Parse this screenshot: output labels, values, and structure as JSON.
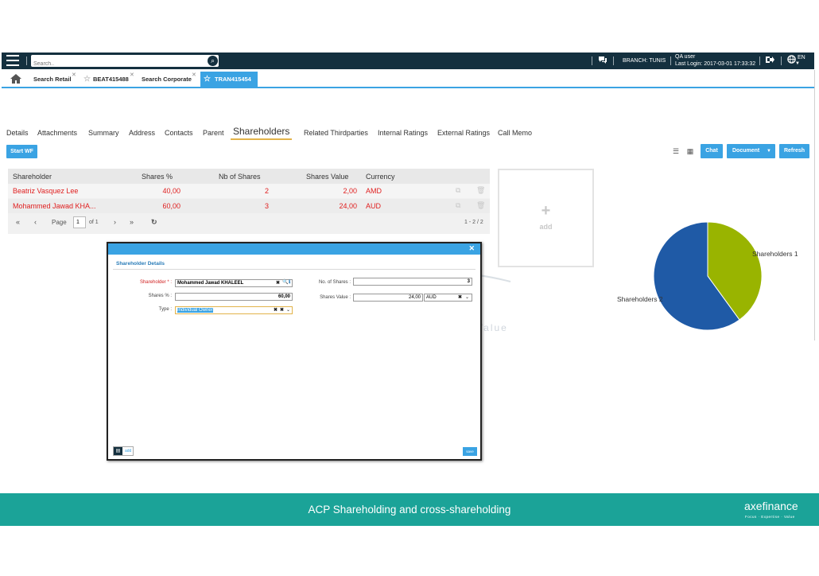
{
  "topbar": {
    "search_placeholder": "Search..",
    "branch": "BRANCH: TUNIS",
    "user": "QA user",
    "last_login": "Last Login: 2017-03-01 17:33:32",
    "lang": "EN"
  },
  "tabs": [
    {
      "label": "Search Retail"
    },
    {
      "label": "BEAT415488"
    },
    {
      "label": "Search Corporate"
    },
    {
      "label": "TRAN415454"
    }
  ],
  "subtabs": [
    "Details",
    "Attachments",
    "Summary",
    "Address",
    "Contacts",
    "Parent",
    "Shareholders",
    "Related Thirdparties",
    "Internal Ratings",
    "External Ratings",
    "Call Memo"
  ],
  "toolbar": {
    "start_wf": "Start WF",
    "chat": "Chat",
    "document": "Document",
    "refresh": "Refresh"
  },
  "table": {
    "headers": [
      "Shareholder",
      "Shares %",
      "Nb of Shares",
      "Shares Value",
      "Currency"
    ],
    "rows": [
      {
        "shareholder": "Beatriz Vasquez Lee",
        "shares_pct": "40,00",
        "nb_shares": "2",
        "shares_value": "2,00",
        "currency": "AMD"
      },
      {
        "shareholder": "Mohammed Jawad KHA...",
        "shares_pct": "60,00",
        "nb_shares": "3",
        "shares_value": "24,00",
        "currency": "AUD"
      }
    ]
  },
  "pager": {
    "page_label": "Page",
    "page": "1",
    "of": "of 1",
    "range": "1 - 2 / 2"
  },
  "add_box": {
    "label": "add"
  },
  "chart_data": {
    "type": "pie",
    "series": [
      {
        "name": "Shareholders 1",
        "value": 40,
        "color": "#99b400"
      },
      {
        "name": "Shareholders 2",
        "value": 60,
        "color": "#1f5aa6"
      }
    ]
  },
  "modal": {
    "title": "Shareholder Details",
    "shareholder_label": "Shareholder * :",
    "shareholder_value": "Mohammed Jawad KHALEEL",
    "shares_pct_label": "Shares % :",
    "shares_pct_value": "60,00",
    "type_label": "Type :",
    "type_value": "Individual Owner",
    "nb_shares_label": "No. of Shares :",
    "nb_shares_value": "3",
    "shares_value_label": "Shares Value :",
    "shares_value_value": "24,00",
    "currency_value": "AUD",
    "add_label": "add",
    "save_label": "save"
  },
  "watermark": {
    "logo": "axefinance",
    "tagline": "Focus · Expertise · Value"
  },
  "footer": {
    "title": "ACP Shareholding and cross-shareholding",
    "logo": "axefinance",
    "tagline": "Focus · Expertise · Value"
  }
}
